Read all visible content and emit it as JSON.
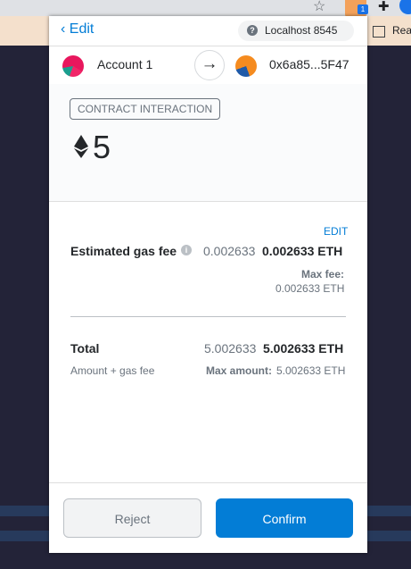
{
  "browser": {
    "extension_badge": "1",
    "reading_list_label": "Rea"
  },
  "header": {
    "back_label": "Edit",
    "network": "Localhost 8545"
  },
  "accounts": {
    "from_name": "Account 1",
    "to_address": "0x6a85...5F47"
  },
  "summary": {
    "action_badge": "CONTRACT INTERACTION",
    "amount": "5"
  },
  "gas": {
    "edit_label": "EDIT",
    "label": "Estimated gas fee",
    "secondary_value": "0.002633",
    "primary_value": "0.002633 ETH",
    "max_fee_label": "Max fee:",
    "max_fee_value": "0.002633 ETH"
  },
  "total": {
    "label": "Total",
    "secondary_value": "5.002633",
    "primary_value": "5.002633 ETH",
    "sub_label": "Amount + gas fee",
    "max_amount_label": "Max amount:",
    "max_amount_value": "5.002633 ETH"
  },
  "footer": {
    "reject_label": "Reject",
    "confirm_label": "Confirm"
  },
  "colors": {
    "primary_blue": "#037dd6",
    "page_background": "#232338"
  }
}
